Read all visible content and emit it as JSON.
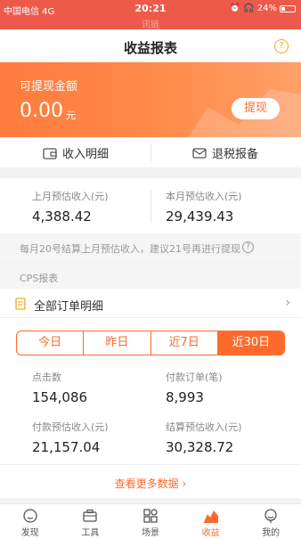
{
  "status_bar": {
    "carrier": "中国电信 4G",
    "time": "20:21",
    "battery": "24%"
  },
  "ghost_title": "讯链",
  "nav": {
    "title": "收益报表"
  },
  "hero": {
    "label": "可提现金额",
    "amount": "0.00",
    "unit": "元",
    "withdraw_label": "提现"
  },
  "quick": {
    "income_detail": "收入明细",
    "tax_report": "退税报备"
  },
  "estimate": {
    "last_month_label": "上月预估收入(元)",
    "last_month_value": "4,388.42",
    "this_month_label": "本月预估收入(元)",
    "this_month_value": "29,439.43"
  },
  "notice": "每月20号结算上月预估收入，建议21号再进行提现",
  "section_title": "CPS报表",
  "orders": {
    "label": "全部订单明细"
  },
  "tabs": [
    {
      "label": "今日"
    },
    {
      "label": "昨日"
    },
    {
      "label": "近7日"
    },
    {
      "label": "近30日"
    }
  ],
  "active_tab": "近30日",
  "metrics": {
    "clicks_label": "点击数",
    "clicks_value": "154,086",
    "paid_orders_label": "付款订单(笔)",
    "paid_orders_value": "8,993",
    "paid_est_label": "付款预估收入(元)",
    "paid_est_value": "21,157.04",
    "settled_est_label": "结算预估收入(元)",
    "settled_est_value": "30,328.72"
  },
  "more_label": "查看更多数据",
  "tabbar": [
    {
      "label": "发现",
      "icon": "discover-icon"
    },
    {
      "label": "工具",
      "icon": "toolbox-icon"
    },
    {
      "label": "场景",
      "icon": "scene-icon"
    },
    {
      "label": "收益",
      "icon": "earnings-icon"
    },
    {
      "label": "我的",
      "icon": "profile-icon"
    }
  ],
  "colors": {
    "accent": "#ff6a2c",
    "status_bar": "#ee5a4a"
  }
}
